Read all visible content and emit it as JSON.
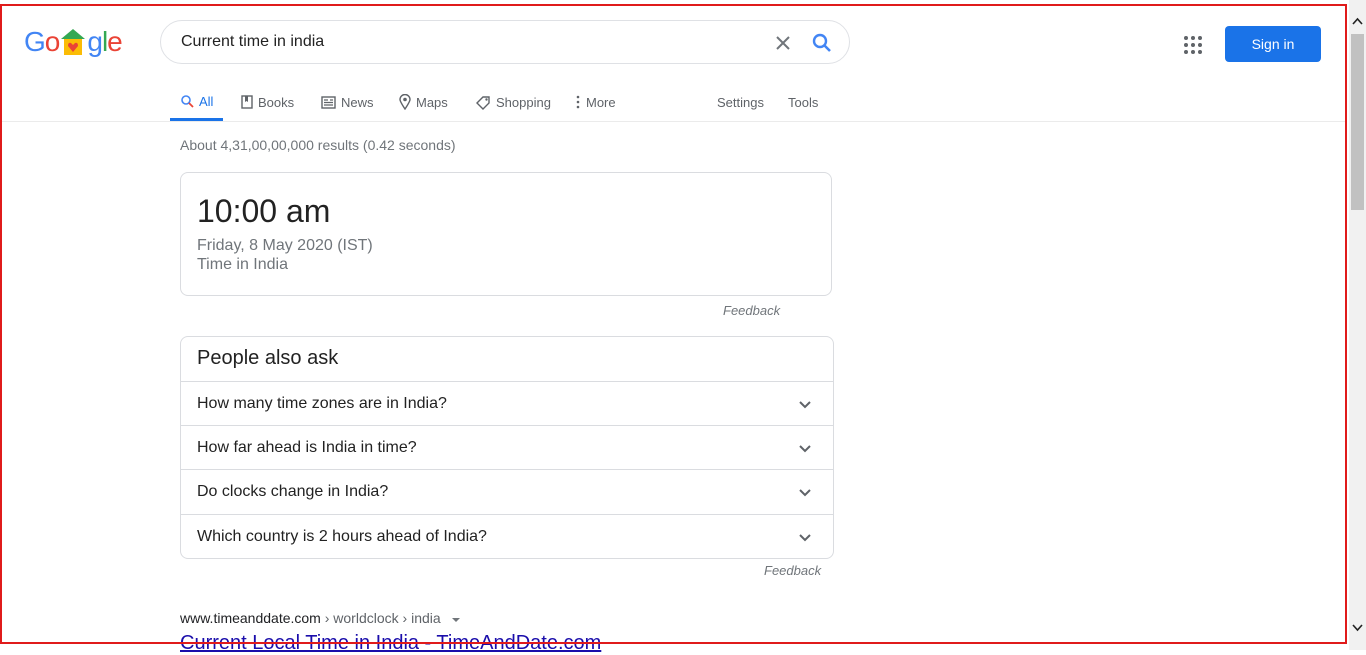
{
  "logo": {
    "letters": [
      "G",
      "o",
      "o",
      "g",
      "l",
      "e"
    ],
    "colors": [
      "#4285f4",
      "#ea4335",
      "#fbbc05",
      "#4285f4",
      "#34a853",
      "#ea4335"
    ],
    "heart": "♥"
  },
  "search": {
    "query": "Current time in india"
  },
  "header": {
    "signin_label": "Sign in",
    "accent": "#1a73e8"
  },
  "tabs": [
    {
      "label": "All",
      "icon": "search-icon"
    },
    {
      "label": "Books",
      "icon": "book-icon"
    },
    {
      "label": "News",
      "icon": "news-icon"
    },
    {
      "label": "Maps",
      "icon": "map-pin-icon"
    },
    {
      "label": "Shopping",
      "icon": "tag-icon"
    },
    {
      "label": "More",
      "icon": "more-vert-icon"
    }
  ],
  "tools": {
    "settings": "Settings",
    "tools": "Tools"
  },
  "stats": "About 4,31,00,00,000 results (0.42 seconds)",
  "time_card": {
    "time": "10:00 am",
    "date": "Friday, 8 May 2020 (IST)",
    "location": "Time in India",
    "feedback": "Feedback"
  },
  "paa": {
    "title": "People also ask",
    "questions": [
      "How many time zones are in India?",
      "How far ahead is India in time?",
      "Do clocks change in India?",
      "Which country is 2 hours ahead of India?"
    ],
    "feedback": "Feedback"
  },
  "result": {
    "domain": "www.timeanddate.com",
    "crumbs": " › worldclock › india",
    "title": "Current Local Time in India - TimeAndDate.com"
  }
}
